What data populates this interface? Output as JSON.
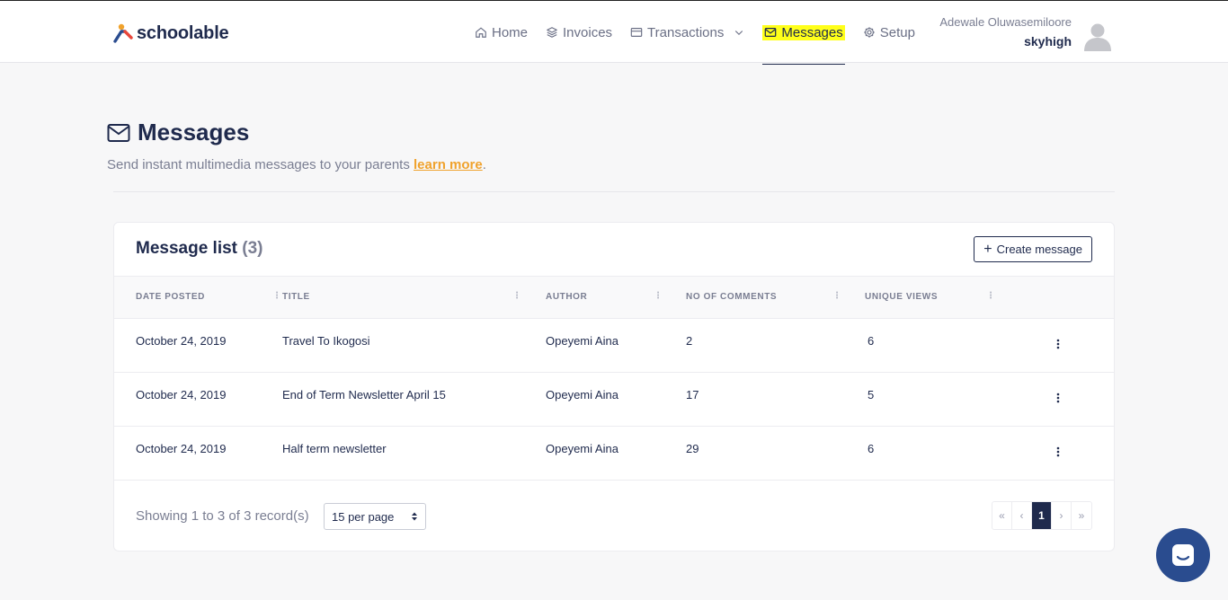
{
  "brand": {
    "name": "schoolable"
  },
  "nav": [
    {
      "label": "Home",
      "icon": "home-icon"
    },
    {
      "label": "Invoices",
      "icon": "layers-icon"
    },
    {
      "label": "Transactions",
      "icon": "card-icon"
    },
    {
      "label": "Messages",
      "icon": "mail-icon"
    },
    {
      "label": "Setup",
      "icon": "gear-icon"
    }
  ],
  "user": {
    "name": "Adewale Oluwasemiloore",
    "org": "skyhigh"
  },
  "page": {
    "title": "Messages",
    "subtitle": "Send instant multimedia messages to your parents",
    "link": "learn more",
    "period": "."
  },
  "card": {
    "title": "Message list",
    "count": "(3)",
    "create_label": "Create message"
  },
  "table": {
    "columns": [
      "Date posted",
      "Title",
      "Author",
      "No of comments",
      "Unique views"
    ],
    "rows": [
      {
        "date": "October 24, 2019",
        "title": "Travel To Ikogosi",
        "author": "Opeyemi Aina",
        "comments": "2",
        "views": "6"
      },
      {
        "date": "October 24, 2019",
        "title": "End of Term Newsletter April 15",
        "author": "Opeyemi Aina",
        "comments": "17",
        "views": "5"
      },
      {
        "date": "October 24, 2019",
        "title": "Half term newsletter",
        "author": "Opeyemi Aina",
        "comments": "29",
        "views": "6"
      }
    ]
  },
  "footer": {
    "showing": "Showing 1 to 3 of 3 record(s)",
    "per_page": "15 per page",
    "pager": [
      "«",
      "‹",
      "1",
      "›",
      "»"
    ]
  },
  "colors": {
    "primary": "#1f2a4d",
    "accent": "#f0a22c",
    "highlight": "#ffff1a",
    "chat": "#2a4c8f"
  }
}
